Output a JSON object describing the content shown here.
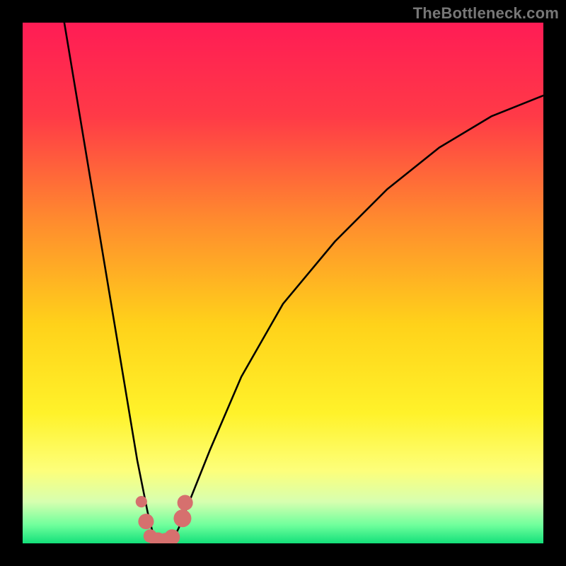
{
  "watermark": "TheBottleneck.com",
  "chart_data": {
    "type": "line",
    "title": "",
    "xlabel": "",
    "ylabel": "",
    "xlim": [
      0,
      100
    ],
    "ylim": [
      0,
      100
    ],
    "grid": false,
    "legend": false,
    "series": [
      {
        "name": "curve",
        "x": [
          8,
          10,
          12,
          14,
          16,
          18,
          20,
          22,
          24,
          25,
          26,
          27,
          28,
          29,
          30,
          32,
          36,
          42,
          50,
          60,
          70,
          80,
          90,
          100
        ],
        "y": [
          100,
          88,
          76,
          64,
          52,
          40,
          28,
          16,
          6,
          2,
          0,
          0,
          0,
          1,
          3,
          8,
          18,
          32,
          46,
          58,
          68,
          76,
          82,
          86
        ]
      }
    ],
    "background_gradient_stops": [
      {
        "offset": 0.0,
        "color": "#ff1c55"
      },
      {
        "offset": 0.18,
        "color": "#ff3a47"
      },
      {
        "offset": 0.38,
        "color": "#ff8b2e"
      },
      {
        "offset": 0.58,
        "color": "#ffd21a"
      },
      {
        "offset": 0.75,
        "color": "#fff22a"
      },
      {
        "offset": 0.86,
        "color": "#fdff7a"
      },
      {
        "offset": 0.92,
        "color": "#d7ffb0"
      },
      {
        "offset": 0.965,
        "color": "#6fff9c"
      },
      {
        "offset": 1.0,
        "color": "#13e07a"
      }
    ],
    "markers": [
      {
        "x": 22.8,
        "y": 8.0,
        "r": 1.1
      },
      {
        "x": 23.7,
        "y": 4.2,
        "r": 1.5
      },
      {
        "x": 24.5,
        "y": 1.4,
        "r": 1.3
      },
      {
        "x": 26.0,
        "y": 0.5,
        "r": 1.6
      },
      {
        "x": 27.4,
        "y": 0.6,
        "r": 1.4
      },
      {
        "x": 28.7,
        "y": 1.2,
        "r": 1.5
      },
      {
        "x": 30.7,
        "y": 4.8,
        "r": 1.7
      },
      {
        "x": 31.2,
        "y": 7.8,
        "r": 1.5
      }
    ]
  }
}
